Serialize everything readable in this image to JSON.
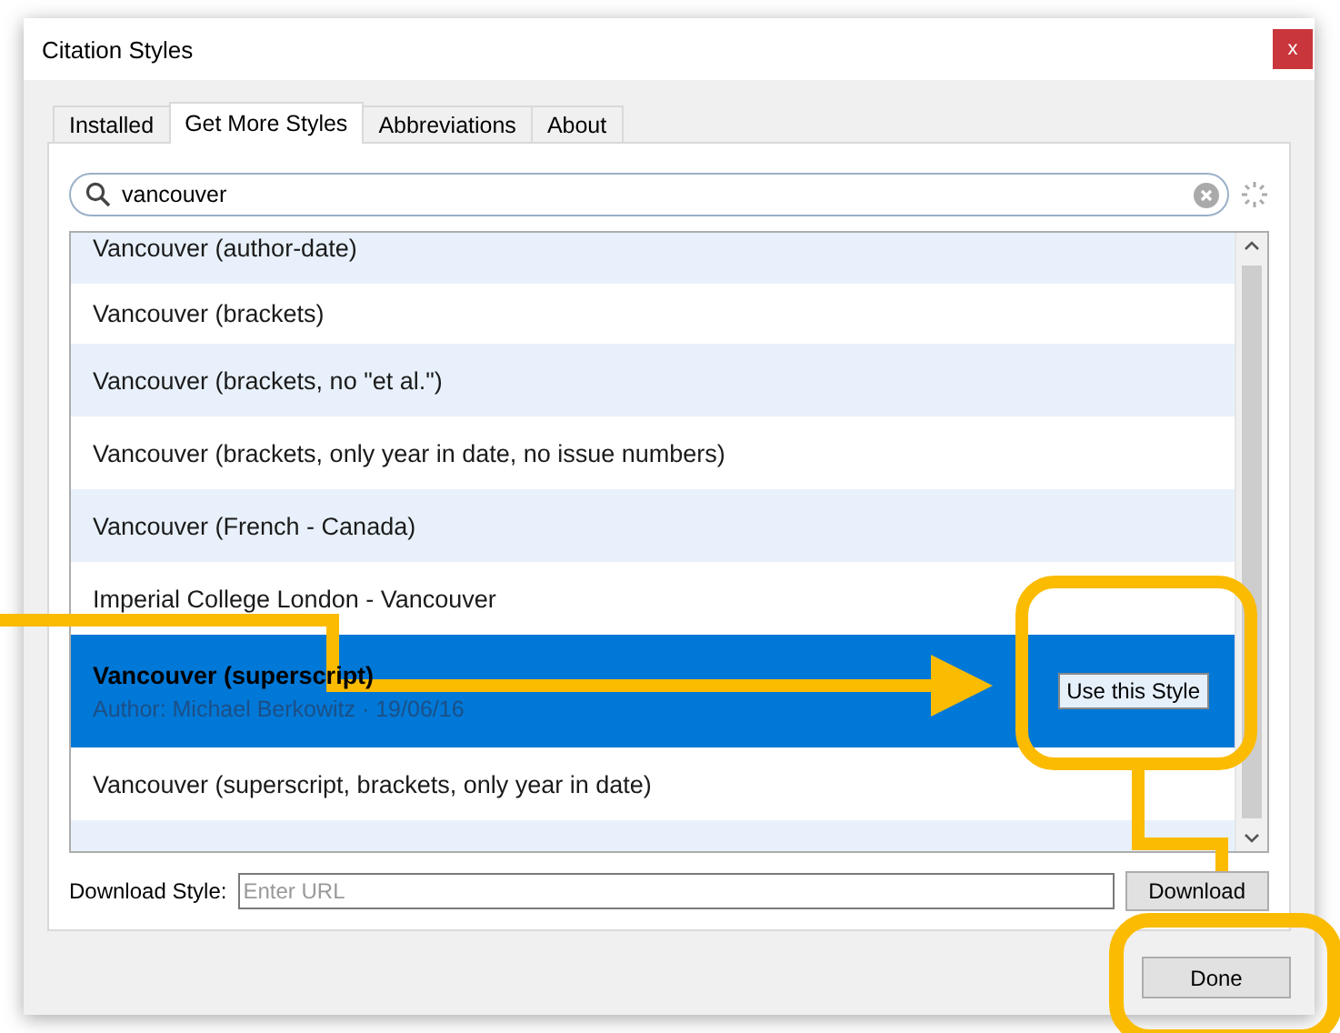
{
  "window": {
    "title": "Citation Styles",
    "close": "x"
  },
  "tabs": [
    {
      "label": "Installed",
      "selected": false
    },
    {
      "label": "Get More Styles",
      "selected": true
    },
    {
      "label": "Abbreviations",
      "selected": false
    },
    {
      "label": "About",
      "selected": false
    }
  ],
  "search": {
    "value": "vancouver"
  },
  "styles": [
    {
      "title": "Vancouver (author-date)",
      "selected": false
    },
    {
      "title": "Vancouver (brackets)",
      "selected": false
    },
    {
      "title": "Vancouver (brackets, no \"et al.\")",
      "selected": false
    },
    {
      "title": "Vancouver (brackets, only year in date, no issue numbers)",
      "selected": false
    },
    {
      "title": "Vancouver (French - Canada)",
      "selected": false
    },
    {
      "title": "Imperial College London - Vancouver",
      "selected": false
    },
    {
      "title": "Vancouver (superscript)",
      "author": "Author: Michael Berkowitz · 19/06/16",
      "action": "Use this Style",
      "selected": true
    },
    {
      "title": "Vancouver (superscript, brackets, only year in date)",
      "selected": false
    }
  ],
  "download": {
    "label": "Download Style:",
    "placeholder": "Enter URL",
    "button": "Download"
  },
  "buttons": [
    "Done"
  ]
}
